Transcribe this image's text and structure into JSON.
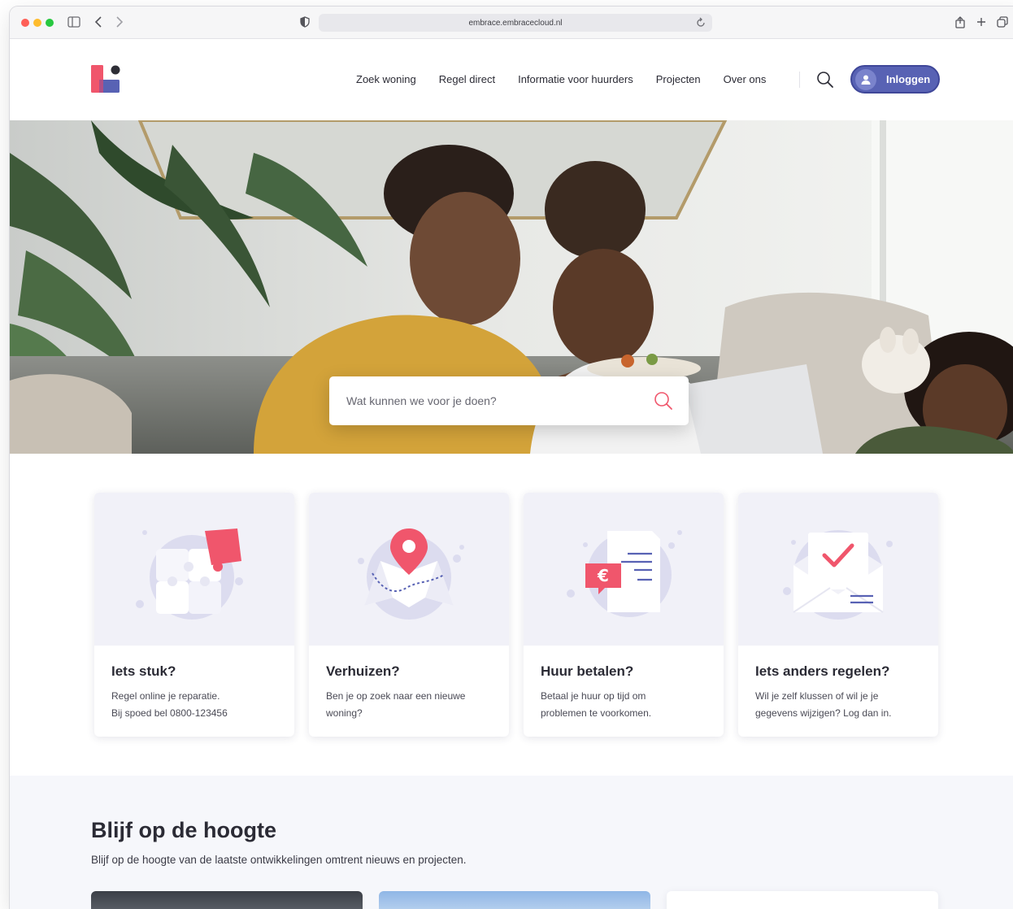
{
  "browser": {
    "url": "embrace.embracecloud.nl"
  },
  "nav": {
    "items": [
      "Zoek woning",
      "Regel direct",
      "Informatie voor huurders",
      "Projecten",
      "Over ons"
    ],
    "login_label": "Inloggen"
  },
  "hero": {
    "search_placeholder": "Wat kunnen we voor je doen?"
  },
  "cards": [
    {
      "title": "Iets stuk?",
      "text_line1": "Regel online je reparatie.",
      "text_line2": "Bij spoed bel 0800-123456",
      "icon": "puzzle-icon"
    },
    {
      "title": "Verhuizen?",
      "text_line1": "Ben je op zoek naar een nieuwe",
      "text_line2": "woning?",
      "icon": "map-pin-icon"
    },
    {
      "title": "Huur betalen?",
      "text_line1": "Betaal je huur op tijd om",
      "text_line2": "problemen te voorkomen.",
      "icon": "invoice-euro-icon"
    },
    {
      "title": "Iets anders regelen?",
      "text_line1": "Wil je zelf klussen of wil je je",
      "text_line2": "gegevens wijzigen? Log dan in.",
      "icon": "envelope-check-icon"
    }
  ],
  "news": {
    "title": "Blijf op de hoogte",
    "subtitle": "Blijf op de hoogte van de laatste ontwikkelingen omtrent nieuws en projecten."
  },
  "colors": {
    "brand_blue": "#5862b4",
    "brand_pink": "#f0566c",
    "text_dark": "#2b2b35"
  }
}
